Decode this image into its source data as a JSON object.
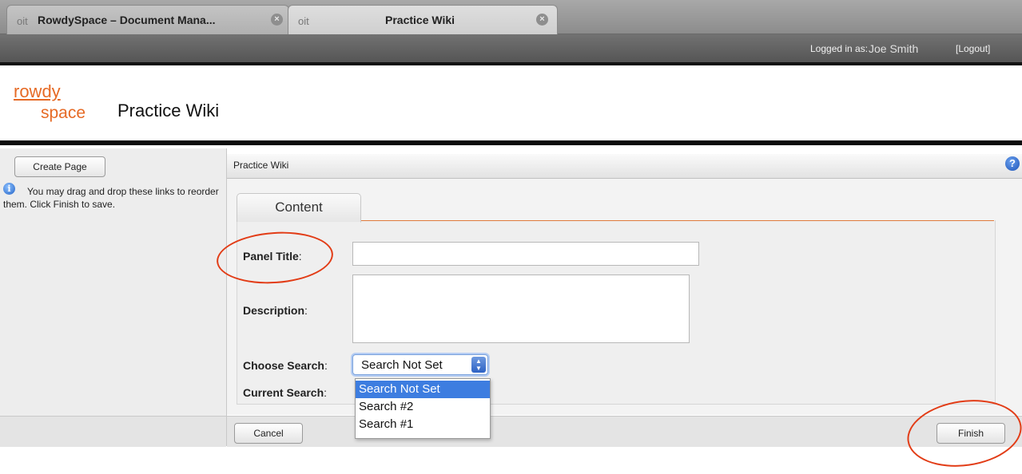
{
  "browser": {
    "tabs": [
      {
        "label": "RowdySpace – Document Mana...",
        "favicon": "oit"
      },
      {
        "label": "Practice Wiki",
        "favicon": "oit"
      }
    ]
  },
  "header": {
    "logged_in_label": "Logged in as:",
    "username": "Joe Smith",
    "logout": "[Logout]",
    "logo_top": "rowdy",
    "logo_bottom": "space",
    "site_title": "Practice Wiki"
  },
  "sidebar": {
    "create_page": "Create Page",
    "help_text": "You may drag and drop these links to reorder them. Click Finish to save."
  },
  "main": {
    "breadcrumb": "Practice Wiki",
    "tab_label": "Content",
    "form": {
      "panel_title_label": "Panel Title",
      "description_label": "Description",
      "choose_search_label": "Choose Search",
      "current_search_label": "Current Search",
      "colon": ":",
      "selected_search": "Search Not Set",
      "search_options": [
        "Search Not Set",
        "Search #2",
        "Search #1"
      ]
    }
  },
  "footer": {
    "cancel": "Cancel",
    "finish": "Finish"
  },
  "colors": {
    "accent_orange": "#e66a25",
    "annotation_red": "#e23c16",
    "selection_blue": "#3d7de0"
  }
}
